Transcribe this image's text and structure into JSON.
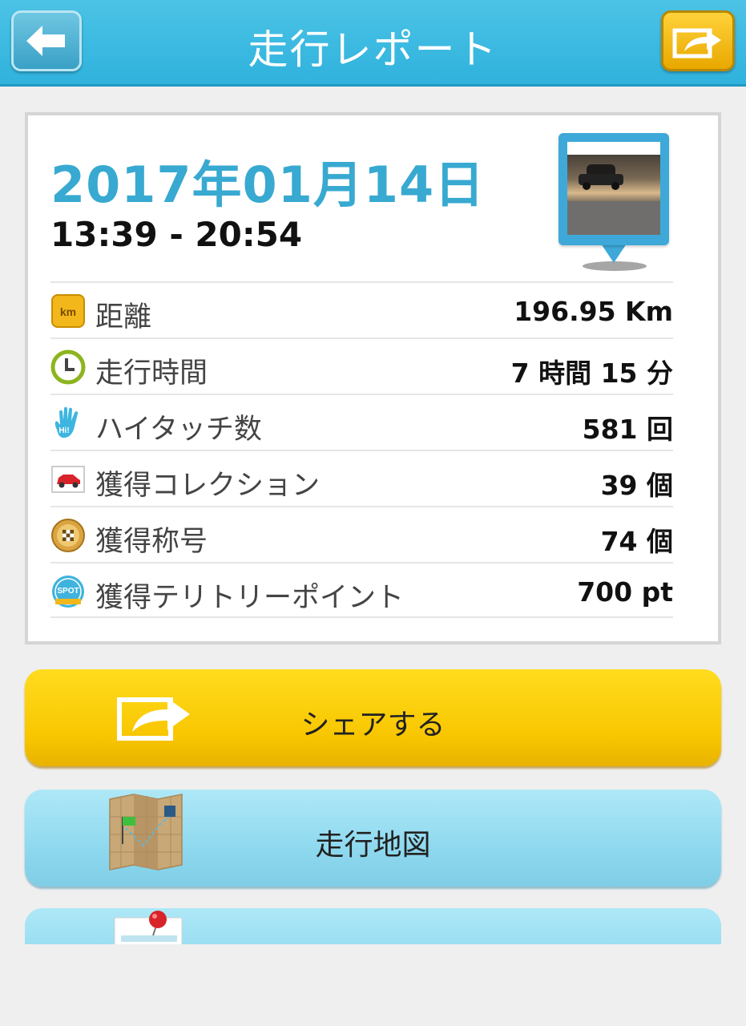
{
  "header": {
    "title": "走行レポート",
    "back_icon": "arrow-left-icon",
    "share_icon": "share-arrow-icon",
    "bar_color": "#3bb8e2",
    "share_color": "#f5bd0c"
  },
  "report": {
    "date": "2017年01月14日",
    "time_range": "13:39 - 20:54",
    "photo_icon": "photo-pin-icon",
    "date_color": "#38a9d1",
    "stats": [
      {
        "icon": "km-icon",
        "label": "距離",
        "value": "196.95 Km"
      },
      {
        "icon": "clock-icon",
        "label": "走行時間",
        "value": "7 時間 15 分"
      },
      {
        "icon": "high-five-hand-icon",
        "label": "ハイタッチ数",
        "value": "581 回"
      },
      {
        "icon": "car-card-icon",
        "label": "獲得コレクション",
        "value": "39 個"
      },
      {
        "icon": "checkered-medal-icon",
        "label": "獲得称号",
        "value": "74 個"
      },
      {
        "icon": "spot-badge-icon",
        "label": "獲得テリトリーポイント",
        "value": "700 pt"
      }
    ]
  },
  "actions": {
    "share_label": "シェアする",
    "share_icon": "share-arrow-icon",
    "map_label": "走行地図",
    "map_icon": "folded-map-icon",
    "third_icon": "pinned-note-icon",
    "share_color": "#f8c600",
    "map_color": "#8fd9ef"
  }
}
